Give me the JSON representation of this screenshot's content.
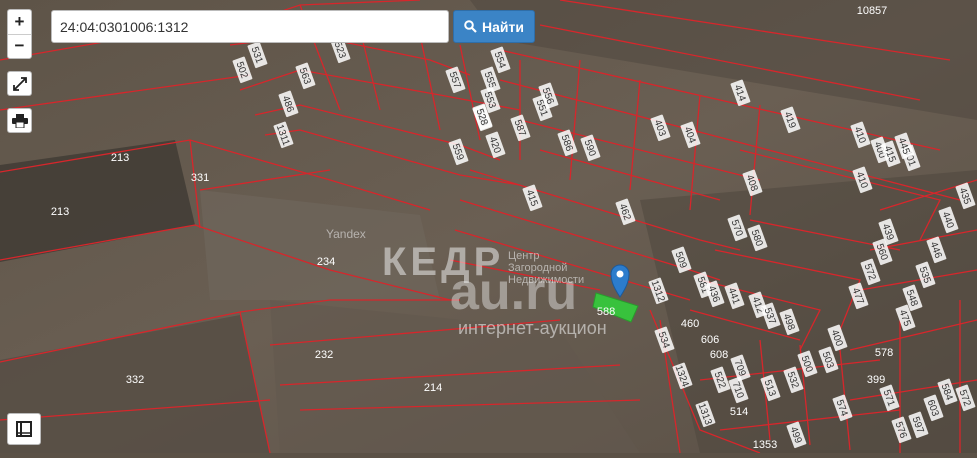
{
  "search": {
    "value": "24:04:0301006:1312"
  },
  "find_label": "Найти",
  "zoom_in": "+",
  "zoom_out": "−",
  "watermark": {
    "brand": "КЕДР",
    "site": "au.ru",
    "tagline": "интернет-аукцион",
    "center_line1": "Центр",
    "center_line2": "Загородной",
    "center_line3": "Недвижимости"
  },
  "yandex_label": "Yandex",
  "parcel_labels": [
    "213",
    "213",
    "331",
    "234",
    "232",
    "332",
    "214",
    "10857",
    "531",
    "502",
    "486",
    "1311",
    "523",
    "563",
    "557",
    "559",
    "555",
    "553",
    "549",
    "528",
    "551",
    "556",
    "587",
    "586",
    "590",
    "554",
    "414",
    "419",
    "400",
    "401",
    "403",
    "404",
    "408",
    "410",
    "415",
    "440",
    "435",
    "439",
    "446",
    "535",
    "548",
    "475",
    "477",
    "560",
    "572",
    "570",
    "580",
    "581",
    "436",
    "441",
    "412",
    "537",
    "498",
    "400",
    "460",
    "606",
    "608",
    "522",
    "709",
    "710",
    "514",
    "513",
    "532",
    "500",
    "503",
    "534",
    "1324",
    "1313",
    "1353",
    "499",
    "574",
    "578",
    "399",
    "571",
    "576",
    "597",
    "603",
    "584",
    "572",
    "588",
    "1312",
    "509",
    "462",
    "445",
    "410",
    "420",
    "415"
  ],
  "colors": {
    "parcel_line": "#d7262b",
    "selected_parcel": "#31d53a",
    "marker": "#2c7ccc",
    "label_bg": "#ffffff"
  }
}
